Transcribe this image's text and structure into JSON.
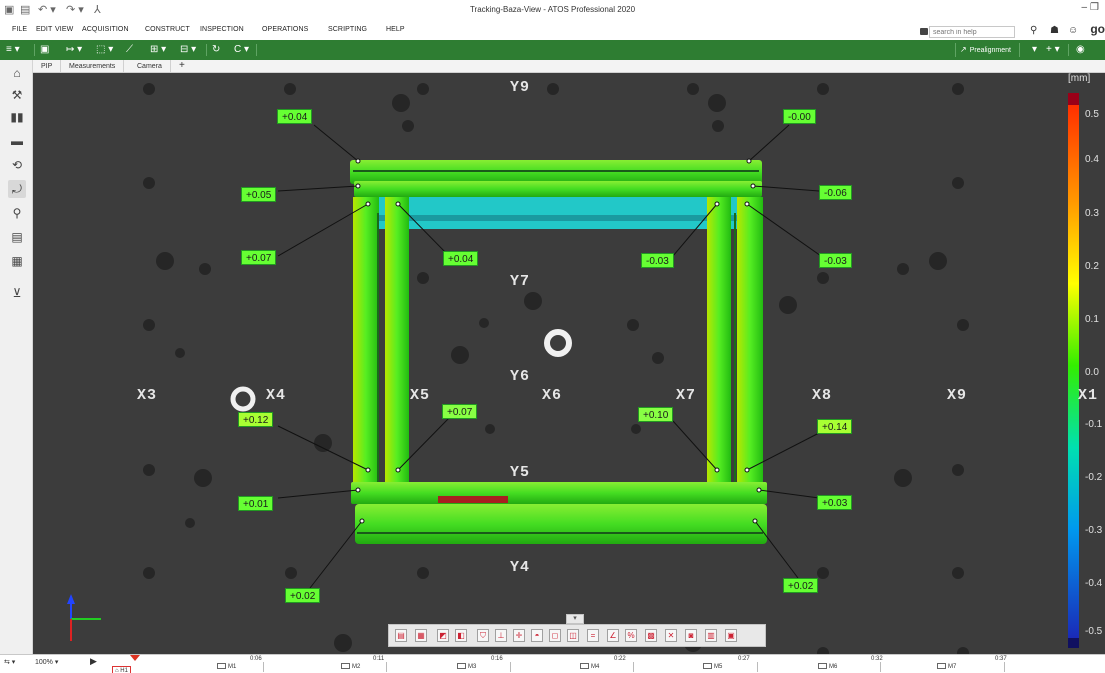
{
  "window": {
    "title": "Tracking-Baza-View - ATOS Professional 2020"
  },
  "menu": {
    "items": [
      "FILE",
      "EDIT",
      "VIEW",
      "ACQUISITION",
      "CONSTRUCT",
      "INSPECTION",
      "OPERATIONS",
      "SCRIPTING",
      "HELP"
    ],
    "search_placeholder": "search in help"
  },
  "toolbar": {
    "prealignment_label": "Prealignment"
  },
  "tabs": [
    "PIP",
    "Measurements",
    "Camera"
  ],
  "tab_add": "+",
  "viewport": {
    "axis_labels": [
      "X3",
      "X4",
      "X5",
      "X6",
      "X7",
      "X8",
      "X9",
      "X1",
      "Y9",
      "Y7",
      "Y6",
      "Y5",
      "Y4"
    ],
    "deviations": [
      "+0.04",
      "-0.00",
      "+0.05",
      "-0.06",
      "+0.07",
      "+0.04",
      "-0.03",
      "-0.03",
      "+0.12",
      "+0.07",
      "+0.10",
      "+0.14",
      "+0.01",
      "+0.03",
      "+0.02",
      "+0.02"
    ]
  },
  "color_scale": {
    "unit": "[mm]",
    "ticks": [
      "0.5",
      "0.4",
      "0.3",
      "0.2",
      "0.1",
      "0.0",
      "-0.1",
      "-0.2",
      "-0.3",
      "-0.4",
      "-0.5"
    ],
    "colors": [
      "#c8001e",
      "#ff2d00",
      "#ff8a00",
      "#ffe600",
      "#b4ff00",
      "#33e600",
      "#00d98a",
      "#00c8d8",
      "#0096e6",
      "#0050d0",
      "#2020b8"
    ]
  },
  "timeline": {
    "zoom": "100%",
    "times": [
      "0:06",
      "0:11",
      "0:16",
      "0:22",
      "0:27",
      "0:32",
      "0:37"
    ],
    "markers": [
      "H1",
      "M1",
      "M2",
      "M3",
      "M4",
      "M5",
      "M6",
      "M7"
    ]
  }
}
